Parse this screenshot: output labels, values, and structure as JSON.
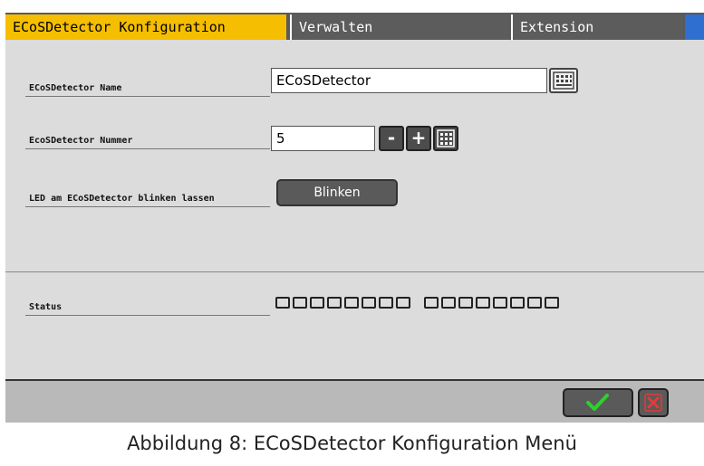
{
  "tabs": [
    {
      "label": "ECoSDetector Konfiguration",
      "active": true
    },
    {
      "label": "Verwalten",
      "active": false
    },
    {
      "label": "Extension",
      "active": false
    }
  ],
  "form": {
    "name_label": "ECoSDetector Name",
    "name_value": "ECoSDetector",
    "number_label": "EcoSDetector Nummer",
    "number_value": "5",
    "minus_label": "-",
    "plus_label": "+",
    "led_label": "LED am ECoSDetector blinken lassen",
    "blink_button": "Blinken"
  },
  "status": {
    "label": "Status",
    "led_groups": [
      8,
      8
    ]
  },
  "caption": "Abbildung 8: ECoSDetector Konfiguration Menü",
  "colors": {
    "active_tab": "#f5be00",
    "tab_bg": "#5c5c5c",
    "ok_check": "#2fcf2f",
    "cancel_x": "#e23b3b"
  }
}
